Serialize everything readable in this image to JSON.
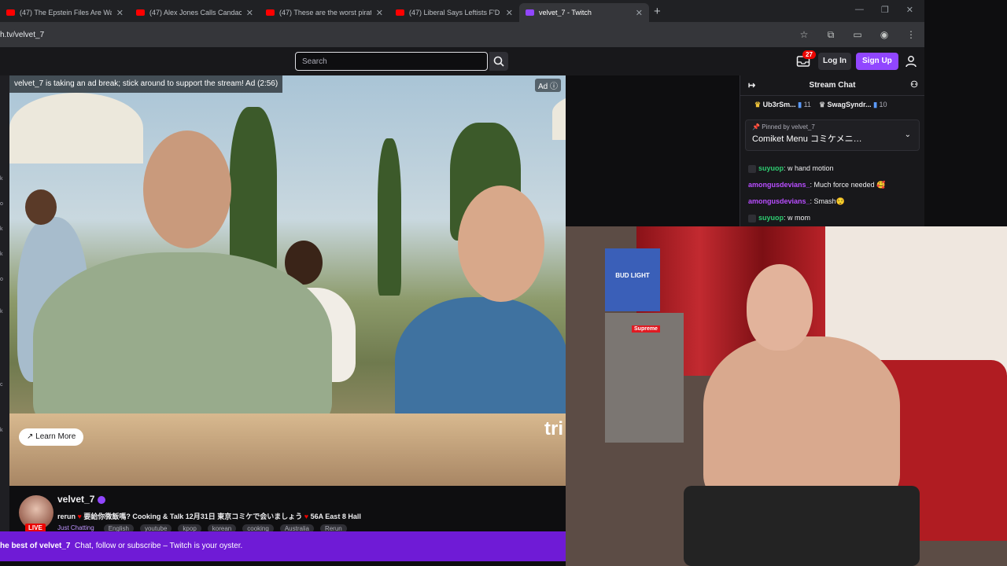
{
  "browser": {
    "tabs": [
      {
        "title": "(47) The Epstein Files Are Way",
        "active": false
      },
      {
        "title": "(47) Alex Jones Calls Candace C",
        "active": false
      },
      {
        "title": "(47) These are the worst pirates",
        "active": false
      },
      {
        "title": "(47) Liberal Says Leftists F'D UP",
        "active": false
      },
      {
        "title": "velvet_7 - Twitch",
        "active": true
      }
    ],
    "new_tab": "+",
    "url": "h.tv/velvet_7"
  },
  "topnav": {
    "search_placeholder": "Search",
    "inbox_count": "27",
    "login_label": "Log In",
    "signup_label": "Sign Up"
  },
  "left_strip_marks": [
    "k",
    "o",
    "k",
    "k",
    "o",
    "k",
    "c",
    "k"
  ],
  "video": {
    "ad_banner": "velvet_7 is taking an ad break; stick around to support the stream! Ad (2:56)",
    "ad_tag": "Ad ⓘ",
    "learn_more": "Learn More",
    "caption_fragment": "tri"
  },
  "channel": {
    "name": "velvet_7",
    "live_label": "LIVE",
    "stream_title_pre": "rerun",
    "stream_title": "要給你微飯嗎? Cooking & Talk 12月31日 東京コミケで会いましょう",
    "stream_title_post": "56A East 8 Hall",
    "category": "Just Chatting",
    "tags": [
      "English",
      "youtube",
      "kpop",
      "korean",
      "cooking",
      "Australia",
      "Rerun"
    ]
  },
  "banner": {
    "lead": "he best of velvet_7",
    "text": "Chat, follow or subscribe – Twitch is your oyster."
  },
  "chat": {
    "title": "Stream Chat",
    "gifters": [
      {
        "name": "Ub3rSm...",
        "count": "11"
      },
      {
        "name": "SwagSyndr...",
        "count": "10"
      }
    ],
    "pinned_by_label": "Pinned by",
    "pinned_by_user": "velvet_7",
    "pinned_message": "Comiket Menu コミケメニ…",
    "messages": [
      {
        "user": "suyuop",
        "text": "w hand motion",
        "mod": true,
        "color": "green"
      },
      {
        "user": "amongusdevians_",
        "text": "Much force needed 🥰",
        "mod": false,
        "color": "purple"
      },
      {
        "user": "amongusdevians_",
        "text": "Smash😌",
        "mod": false,
        "color": "purple"
      },
      {
        "user": "suyuop",
        "text": "w mom",
        "mod": true,
        "color": "green"
      }
    ]
  },
  "webcam": {
    "box_text": "BUD LIGHT",
    "sticker_text": "Supreme"
  },
  "colors": {
    "twitch_purple": "#9146ff",
    "live_red": "#eb0400",
    "banner_purple": "#6f1bd6"
  }
}
